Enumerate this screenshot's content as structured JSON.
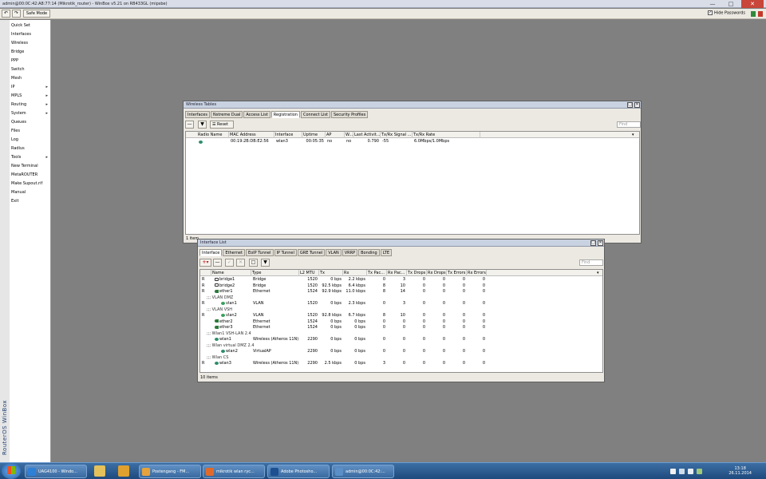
{
  "titlebar": {
    "title": "admin@00:0C:42:A8:77:14 (Mikrotik_router) - WinBox v5.21 on RB433GL (mipsbe)"
  },
  "toolbar": {
    "undo_icon": "undo-icon",
    "redo_icon": "redo-icon",
    "safe_mode": "Safe Mode",
    "hide_passwords": "Hide Passwords",
    "hide_passwords_checked": true
  },
  "sidebar": {
    "brand": "RouterOS WinBox",
    "items": [
      {
        "label": "Quick Set",
        "sub": false
      },
      {
        "label": "Interfaces",
        "sub": false
      },
      {
        "label": "Wireless",
        "sub": false
      },
      {
        "label": "Bridge",
        "sub": false
      },
      {
        "label": "PPP",
        "sub": false
      },
      {
        "label": "Switch",
        "sub": false
      },
      {
        "label": "Mesh",
        "sub": false
      },
      {
        "label": "IP",
        "sub": true
      },
      {
        "label": "MPLS",
        "sub": true
      },
      {
        "label": "Routing",
        "sub": true
      },
      {
        "label": "System",
        "sub": true
      },
      {
        "label": "Queues",
        "sub": false
      },
      {
        "label": "Files",
        "sub": false
      },
      {
        "label": "Log",
        "sub": false
      },
      {
        "label": "Radius",
        "sub": false
      },
      {
        "label": "Tools",
        "sub": true
      },
      {
        "label": "New Terminal",
        "sub": false
      },
      {
        "label": "MetaROUTER",
        "sub": false
      },
      {
        "label": "Make Supout.rif",
        "sub": false
      },
      {
        "label": "Manual",
        "sub": false
      },
      {
        "label": "Exit",
        "sub": false
      }
    ]
  },
  "wireless": {
    "title": "Wireless Tables",
    "tabs": [
      "Interfaces",
      "Nstreme Dual",
      "Access List",
      "Registration",
      "Connect List",
      "Security Profiles"
    ],
    "active_tab": 3,
    "reset_label": "Reset",
    "find_placeholder": "Find",
    "columns": [
      "Radio Name",
      "MAC Address",
      "Interface",
      "Uptime",
      "AP",
      "W...",
      "Last Activit...",
      "Tx/Rx Signal ...",
      "Tx/Rx Rate"
    ],
    "rows": [
      {
        "radio_name": "",
        "mac": "00:19:2B:DB:E2:56",
        "interface": "wlan3",
        "uptime": "00:05:35",
        "ap": "no",
        "w": "no",
        "last_activity": "0.790",
        "signal": "-55",
        "rate": "6.0Mbps/1.0Mbps"
      }
    ],
    "status": "1 item"
  },
  "iface": {
    "title": "Interface List",
    "tabs": [
      "Interface",
      "Ethernet",
      "EoIP Tunnel",
      "IP Tunnel",
      "GRE Tunnel",
      "VLAN",
      "VRRP",
      "Bonding",
      "LTE"
    ],
    "active_tab": 0,
    "find_placeholder": "Find",
    "columns": [
      "",
      "Name",
      "Type",
      "L2 MTU",
      "Tx",
      "Rx",
      "Tx Pac...",
      "Rx Pac...",
      "Tx Drops",
      "Rx Drops",
      "Tx Errors",
      "Rx Errors"
    ],
    "rows": [
      {
        "kind": "row",
        "flag": "R",
        "name": "bridge1",
        "icon": "bridge-icon",
        "indent": 1,
        "type": "Bridge",
        "mtu": "1520",
        "tx": "0 bps",
        "rx": "2.2 kbps",
        "txp": "0",
        "rxp": "3",
        "txd": "0",
        "rxd": "0",
        "txe": "0",
        "rxe": "0"
      },
      {
        "kind": "row",
        "flag": "R",
        "name": "bridge2",
        "icon": "bridge-icon",
        "indent": 1,
        "type": "Bridge",
        "mtu": "1520",
        "tx": "92.5 kbps",
        "rx": "6.4 kbps",
        "txp": "8",
        "rxp": "10",
        "txd": "0",
        "rxd": "0",
        "txe": "0",
        "rxe": "0"
      },
      {
        "kind": "row",
        "flag": "R",
        "name": "ether1",
        "icon": "ethernet-icon",
        "indent": 1,
        "type": "Ethernet",
        "mtu": "1524",
        "tx": "92.9 kbps",
        "rx": "11.0 kbps",
        "txp": "8",
        "rxp": "14",
        "txd": "0",
        "rxd": "0",
        "txe": "0",
        "rxe": "0"
      },
      {
        "kind": "group",
        "label": ";;; VLAN DMZ"
      },
      {
        "kind": "row",
        "flag": "R",
        "name": "vlan1",
        "icon": "vlan-icon",
        "indent": 2,
        "type": "VLAN",
        "mtu": "1520",
        "tx": "0 bps",
        "rx": "2.3 kbps",
        "txp": "0",
        "rxp": "3",
        "txd": "0",
        "rxd": "0",
        "txe": "0",
        "rxe": "0"
      },
      {
        "kind": "group",
        "label": ";;; VLAN VSH"
      },
      {
        "kind": "row",
        "flag": "R",
        "name": "vlan2",
        "icon": "vlan-icon",
        "indent": 2,
        "type": "VLAN",
        "mtu": "1520",
        "tx": "92.8 kbps",
        "rx": "6.7 kbps",
        "txp": "8",
        "rxp": "10",
        "txd": "0",
        "rxd": "0",
        "txe": "0",
        "rxe": "0"
      },
      {
        "kind": "row",
        "flag": "",
        "name": "ether2",
        "icon": "ethernet-icon",
        "indent": 1,
        "type": "Ethernet",
        "mtu": "1524",
        "tx": "0 bps",
        "rx": "0 bps",
        "txp": "0",
        "rxp": "0",
        "txd": "0",
        "rxd": "0",
        "txe": "0",
        "rxe": "0"
      },
      {
        "kind": "row",
        "flag": "",
        "name": "ether3",
        "icon": "ethernet-icon",
        "indent": 1,
        "type": "Ethernet",
        "mtu": "1524",
        "tx": "0 bps",
        "rx": "0 bps",
        "txp": "0",
        "rxp": "0",
        "txd": "0",
        "rxd": "0",
        "txe": "0",
        "rxe": "0"
      },
      {
        "kind": "group",
        "label": ";;; Wlan1 VSH-LAN 2.4"
      },
      {
        "kind": "row",
        "flag": "",
        "name": "wlan1",
        "icon": "wireless-icon",
        "indent": 1,
        "type": "Wireless (Atheros 11N)",
        "mtu": "2290",
        "tx": "0 bps",
        "rx": "0 bps",
        "txp": "0",
        "rxp": "0",
        "txd": "0",
        "rxd": "0",
        "txe": "0",
        "rxe": "0"
      },
      {
        "kind": "group",
        "label": ";;; Wlan virtual DMZ 2.4"
      },
      {
        "kind": "row",
        "flag": "",
        "name": "wlan2",
        "icon": "virtual-ap-icon",
        "indent": 2,
        "type": "VirtualAP",
        "mtu": "2290",
        "tx": "0 bps",
        "rx": "0 bps",
        "txp": "0",
        "rxp": "0",
        "txd": "0",
        "rxd": "0",
        "txe": "0",
        "rxe": "0"
      },
      {
        "kind": "group",
        "label": ";;; Wlan CS"
      },
      {
        "kind": "row",
        "flag": "R",
        "name": "wlan3",
        "icon": "wireless-icon",
        "indent": 1,
        "type": "Wireless (Atheros 11N)",
        "mtu": "2290",
        "tx": "2.5 kbps",
        "rx": "0 bps",
        "txp": "3",
        "rxp": "0",
        "txd": "0",
        "rxd": "0",
        "txe": "0",
        "rxe": "0"
      }
    ],
    "status": "10 items"
  },
  "taskbar": {
    "tasks": [
      {
        "label": "UAG4100 - Windo...",
        "icon_color": "#2e7fd6"
      },
      {
        "label": "Postengang - FM...",
        "icon_color": "#e8a23a"
      },
      {
        "label": "mikrotik wlan ryc...",
        "icon_color": "#e06a2a"
      },
      {
        "label": "Adobe Photosho...",
        "icon_color": "#1d4f91"
      },
      {
        "label": "admin@00:0C:42:...",
        "icon_color": "#5a8fc8"
      }
    ],
    "time": "13:18",
    "date": "26.11.2014"
  }
}
